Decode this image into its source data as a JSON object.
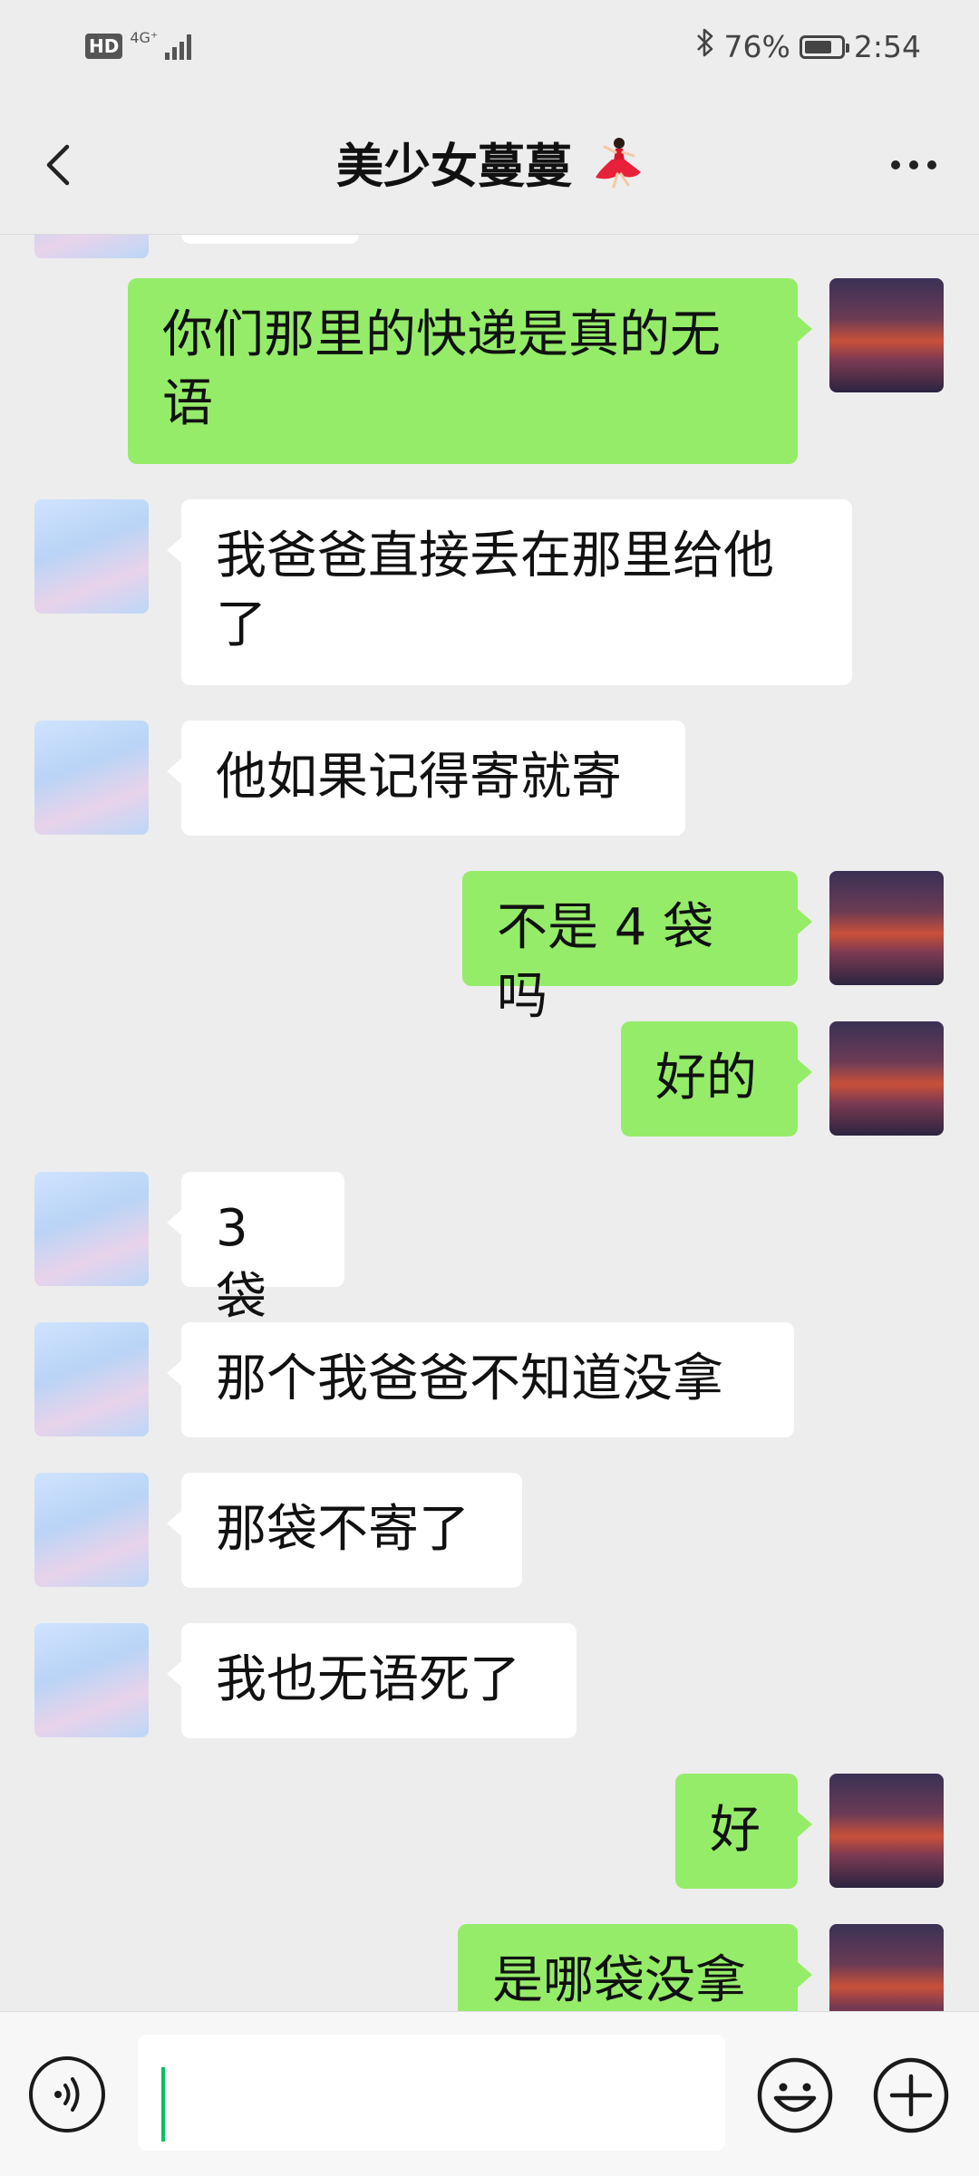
{
  "status_bar": {
    "hd": "HD",
    "network": "4G⁺",
    "battery_percent": "76%",
    "battery_level": 0.76,
    "time": "2:54"
  },
  "header": {
    "title": "美少女蔓蔓",
    "title_emoji_icon": "dancer-emoji-icon"
  },
  "messages": [
    {
      "from": "me",
      "text": "你们那里的快递是真的无语"
    },
    {
      "from": "her",
      "text": "我爸爸直接丢在那里给他了"
    },
    {
      "from": "her",
      "text": "他如果记得寄就寄"
    },
    {
      "from": "me",
      "text": "不是 4 袋吗"
    },
    {
      "from": "me",
      "text": "好的"
    },
    {
      "from": "her",
      "text": "3 袋"
    },
    {
      "from": "her",
      "text": "那个我爸爸不知道没拿"
    },
    {
      "from": "her",
      "text": "那袋不寄了"
    },
    {
      "from": "her",
      "text": "我也无语死了"
    },
    {
      "from": "me",
      "text": "好"
    },
    {
      "from": "me",
      "text": "是哪袋没拿"
    }
  ],
  "input_bar": {
    "value": "",
    "voice_icon": "voice-icon",
    "emoji_icon": "emoji-icon",
    "plus_icon": "plus-icon"
  },
  "colors": {
    "background": "#ededed",
    "my_bubble": "#95ec69",
    "their_bubble": "#ffffff",
    "cursor": "#07c160"
  }
}
